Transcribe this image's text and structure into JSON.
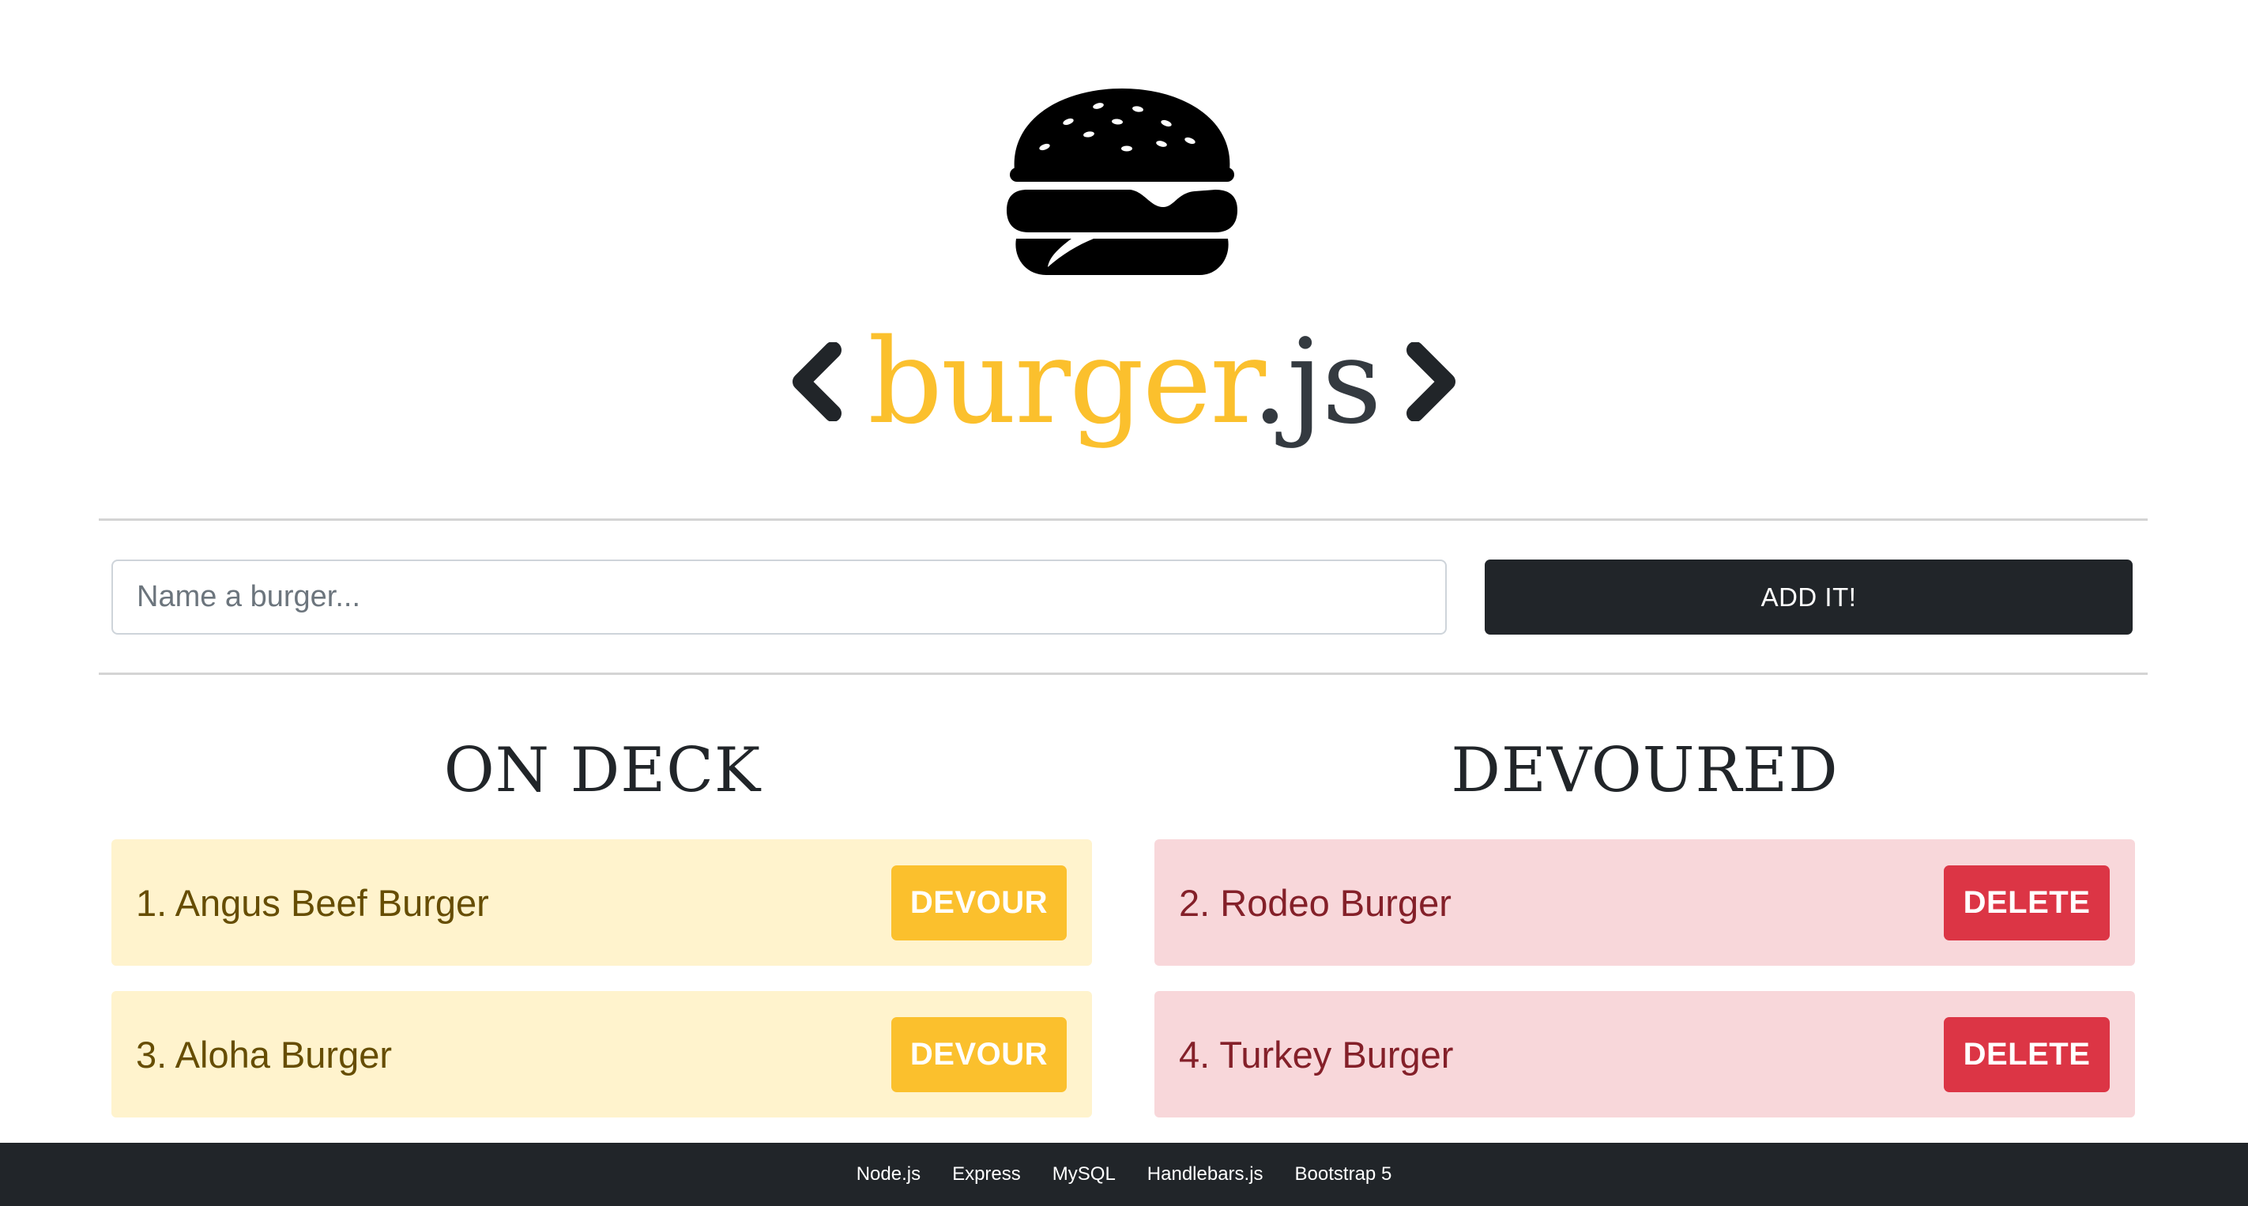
{
  "header": {
    "logo_icon": "burger-icon",
    "title_main": "burger",
    "title_ext": ".js",
    "left_icon": "chevron-left-icon",
    "right_icon": "chevron-right-icon"
  },
  "form": {
    "placeholder": "Name a burger...",
    "value": "",
    "submit_label": "ADD IT!"
  },
  "columns": {
    "on_deck": {
      "heading": "ON DECK",
      "items": [
        {
          "label": "1. Angus Beef Burger",
          "action": "DEVOUR"
        },
        {
          "label": "3. Aloha Burger",
          "action": "DEVOUR"
        }
      ]
    },
    "devoured": {
      "heading": "DEVOURED",
      "items": [
        {
          "label": "2. Rodeo Burger",
          "action": "DELETE"
        },
        {
          "label": "4. Turkey Burger",
          "action": "DELETE"
        }
      ]
    }
  },
  "footer": {
    "links": [
      "Node.js",
      "Express",
      "MySQL",
      "Handlebars.js",
      "Bootstrap 5"
    ]
  },
  "colors": {
    "accent": "#fbc02d",
    "dark": "#212529",
    "danger": "#dc3545",
    "warning_bg": "#fff3cd",
    "danger_bg": "#f8d7da"
  }
}
